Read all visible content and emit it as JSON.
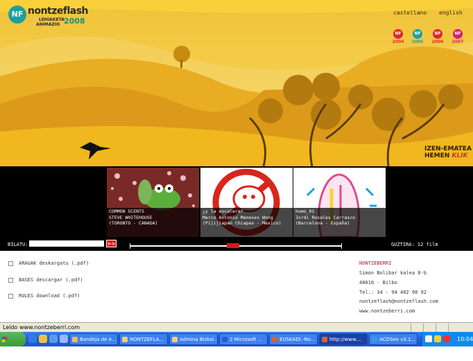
{
  "header": {
    "logo_badge": "NF",
    "logo_name": "nontzeflash",
    "logo_sub1": "LEHIAKETA",
    "logo_sub2": "ANIMAZIO",
    "logo_year": "2008",
    "languages": [
      "castellano",
      "english"
    ],
    "years": [
      {
        "label": "2004",
        "color": "#e3262d"
      },
      {
        "label": "2005",
        "color": "#1ba0a0"
      },
      {
        "label": "2006",
        "color": "#e3262d"
      },
      {
        "label": "2007",
        "color": "#d81e73"
      }
    ],
    "register": {
      "line1": "IZEN-EMATEA",
      "line2": "HEMEN",
      "klik": "KLIK"
    }
  },
  "films": [
    {
      "title": "COMMON SCENTS",
      "author": "STEVE WHITEHOUSE",
      "place": "(TORONTO - CANADA)"
    },
    {
      "title": "¿y la escalera?",
      "author": "Marco Antonio Meneses Wong",
      "place": "(Pijijiapan Chiapas - Mexico)"
    },
    {
      "title": "homo_01",
      "author": "Jordi Rosales Carrasco",
      "place": "(Barcelona - España)"
    }
  ],
  "search": {
    "label": "BILATU:",
    "value": "",
    "go": ">>"
  },
  "count_text": "GUZTIRA: 12 film",
  "downloads": [
    {
      "key": "ARAUAK",
      "text": "deskargatu  (.pdf)"
    },
    {
      "key": "BASES",
      "text": "descargar  (.pdf)"
    },
    {
      "key": "RULES",
      "text": "download  (.pdf)"
    }
  ],
  "contact": {
    "name": "NONTZEBERRI",
    "address": "Simon Bolibar kalea 8-b",
    "city": "48010 - Bilbo",
    "phone": "Tel.: 34 - 94 402 90 92",
    "email": "nontzeflash@nontzeflash.com",
    "web": "www.nontzeberri.com"
  },
  "status_text": "Leído www.nontzeberri.com",
  "taskbar": {
    "start": "Inicio",
    "items": [
      {
        "label": "Bandeja de e...",
        "icon": "#f0c040",
        "active": false
      },
      {
        "label": "NONTZEFLA...",
        "icon": "#f0d070",
        "active": false
      },
      {
        "label": "Admina Bizkai...",
        "icon": "#f0d070",
        "active": false
      },
      {
        "label": "2 Microsoft ...",
        "icon": "#2a5bd7",
        "active": false
      },
      {
        "label": "EUSKADI.-No...",
        "icon": "#e06020",
        "active": false
      },
      {
        "label": "http://www....",
        "icon": "#e06020",
        "active": true
      },
      {
        "label": "ACDSee v3.1...",
        "icon": "#30a0e0",
        "active": false
      }
    ],
    "clock": "10:04"
  }
}
